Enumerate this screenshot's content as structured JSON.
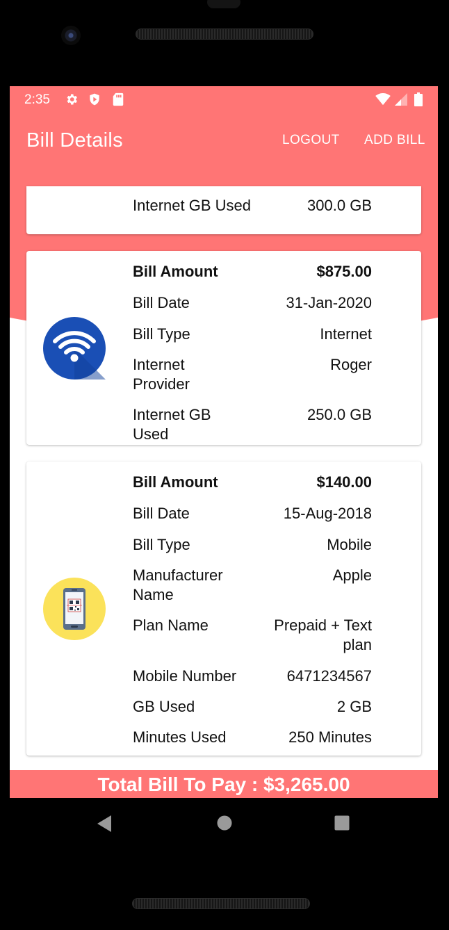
{
  "status_bar": {
    "time": "2:35"
  },
  "app_bar": {
    "title": "Bill Details",
    "logout_label": "LOGOUT",
    "add_bill_label": "ADD BILL"
  },
  "bills": [
    {
      "rows": [
        {
          "label": "Internet GB Used",
          "value": "300.0 GB"
        }
      ]
    },
    {
      "icon": "wifi-icon",
      "rows": [
        {
          "label": "Bill Amount",
          "value": "$875.00"
        },
        {
          "label": "Bill Date",
          "value": "31-Jan-2020"
        },
        {
          "label": "Bill Type",
          "value": "Internet"
        },
        {
          "label": "Internet Provider",
          "value": "Roger"
        },
        {
          "label": "Internet GB Used",
          "value": "250.0 GB"
        }
      ]
    },
    {
      "icon": "mobile-qr-icon",
      "rows": [
        {
          "label": "Bill Amount",
          "value": "$140.00"
        },
        {
          "label": "Bill Date",
          "value": "15-Aug-2018"
        },
        {
          "label": "Bill Type",
          "value": "Mobile"
        },
        {
          "label": "Manufacturer Name",
          "value": "Apple"
        },
        {
          "label": "Plan Name",
          "value": "Prepaid + Text plan"
        },
        {
          "label": "Mobile Number",
          "value": "6471234567"
        },
        {
          "label": "GB Used",
          "value": "2 GB"
        },
        {
          "label": "Minutes Used",
          "value": "250 Minutes"
        }
      ]
    }
  ],
  "footer": {
    "total_text": "Total Bill To Pay : $3,265.00"
  },
  "colors": {
    "accent": "#ff7575",
    "wifi_blue": "#1a4fb5",
    "mobile_yellow": "#fbe25a"
  }
}
